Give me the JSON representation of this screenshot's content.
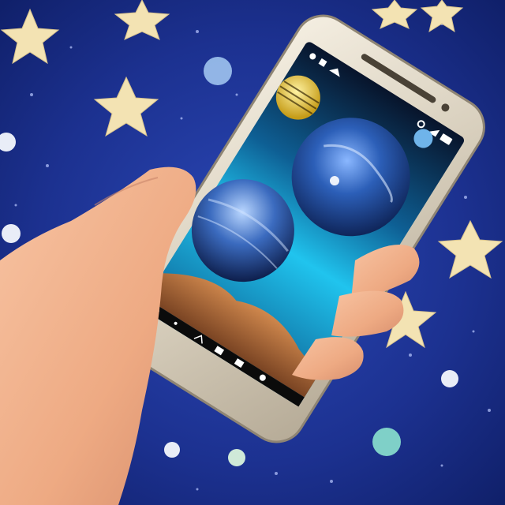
{
  "scene": {
    "description_tag": "photo-hand-holding-phone-space-wallpaper",
    "background": "#1c3190",
    "accent_star": "#f3e3b3",
    "phone_body": "#e8dfcf",
    "screen_sky_top": "#08142b",
    "screen_sky_mid": "#18b8e6",
    "planet_blue": "#2b5ab2",
    "planet_striped": "#e9cf4a",
    "rock_color": "#b47443",
    "skin_color": "#f1b48f"
  },
  "status_bar": {
    "left_icons": [
      "notification-icon",
      "square-icon",
      "wifi-icon"
    ],
    "right_icons": [
      "circle-icon",
      "signal-icon",
      "battery-icon"
    ]
  },
  "nav_bar": {
    "icons": [
      "back-icon",
      "dot-icon",
      "up-icon",
      "apps-icon",
      "screenshot-icon",
      "settings-icon"
    ]
  }
}
